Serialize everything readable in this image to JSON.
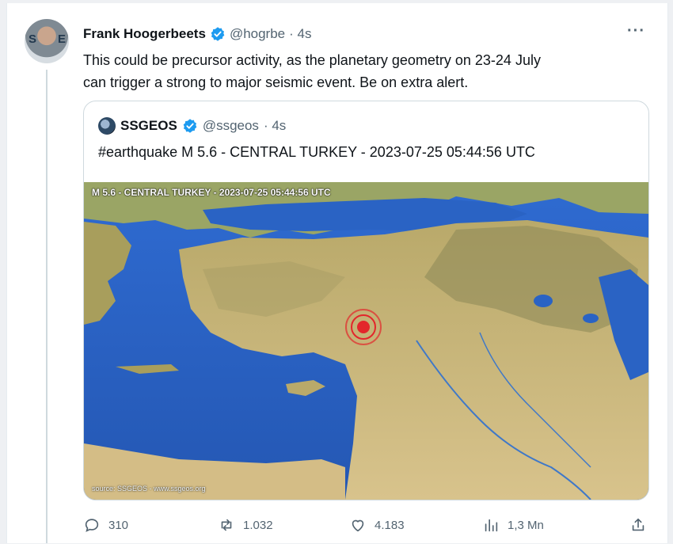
{
  "tweet": {
    "author_name": "Frank Hoogerbeets",
    "handle": "@hogrbe",
    "time": "· 4s",
    "more_icon": "more-horizontal-icon",
    "text_lines": [
      "This could be precursor activity, as the planetary geometry on 23-24 July",
      "can trigger a strong to major seismic event. Be on extra alert."
    ]
  },
  "quote": {
    "author_name": "SSGEOS",
    "handle": "@ssgeos",
    "time": "· 4s",
    "text": "#earthquake M 5.6 - CENTRAL TURKEY - 2023-07-25 05:44:56 UTC",
    "map": {
      "title": "M 5.6 - CENTRAL TURKEY - 2023-07-25 05:44:56 UTC",
      "source": "source: SSGEOS - www.ssgeos.org"
    }
  },
  "actions": {
    "replies": "310",
    "retweets": "1.032",
    "likes": "4.183",
    "views": "1,3 Mn"
  },
  "colors": {
    "verified": "#1d9bf0",
    "sea": "#2a63c4",
    "land": "#c9b478",
    "epicenter": "#e3262b"
  }
}
